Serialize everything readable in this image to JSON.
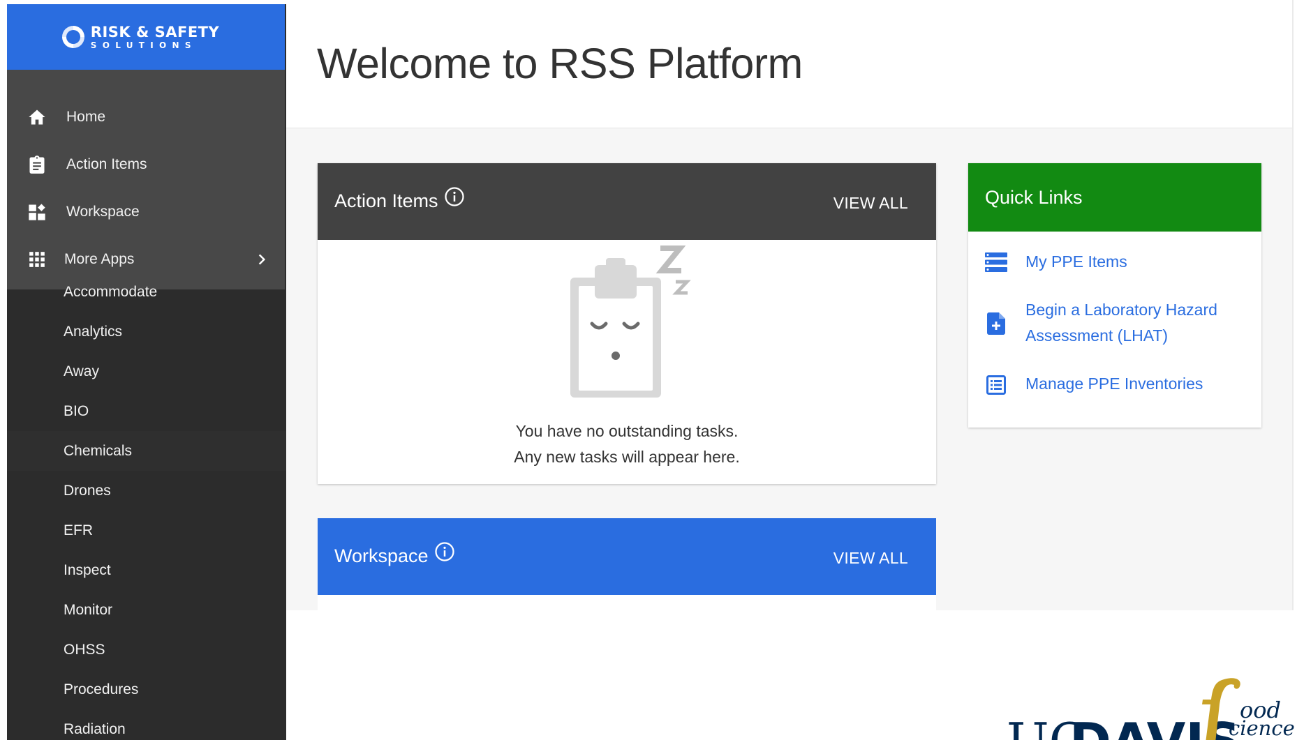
{
  "brand": {
    "title": "RISK & SAFETY",
    "subtitle": "SOLUTIONS"
  },
  "sidebar": {
    "nav": [
      {
        "label": "Home",
        "icon": "home-icon"
      },
      {
        "label": "Action Items",
        "icon": "clipboard-icon"
      },
      {
        "label": "Workspace",
        "icon": "workspace-icon"
      },
      {
        "label": "More Apps",
        "icon": "apps-grid-icon"
      }
    ],
    "apps": [
      "Accommodate",
      "Analytics",
      "Away",
      "BIO",
      "Chemicals",
      "Drones",
      "EFR",
      "Inspect",
      "Monitor",
      "OHSS",
      "Procedures",
      "Radiation"
    ]
  },
  "page": {
    "title": "Welcome to RSS Platform"
  },
  "action_items": {
    "title": "Action Items",
    "view_all": "VIEW ALL",
    "empty_line1": "You have no outstanding tasks.",
    "empty_line2": "Any new tasks will appear here."
  },
  "workspace": {
    "title": "Workspace",
    "view_all": "VIEW ALL"
  },
  "quick_links": {
    "title": "Quick Links",
    "items": [
      {
        "label": "My PPE Items",
        "icon": "list-icon"
      },
      {
        "label": "Begin a Laboratory Hazard Assessment (LHAT)",
        "icon": "add-document-icon"
      },
      {
        "label": "Manage PPE Inventories",
        "icon": "inventory-list-icon"
      }
    ]
  },
  "footer": {
    "logo_text": "UC DAVIS food science &"
  },
  "colors": {
    "brand_blue": "#2a6de0",
    "quick_links_green": "#128a12",
    "sidebar_dark": "#2c2c2c",
    "nav_gray": "#484848",
    "ucd_navy": "#022851",
    "ucd_gold": "#c9a227"
  }
}
